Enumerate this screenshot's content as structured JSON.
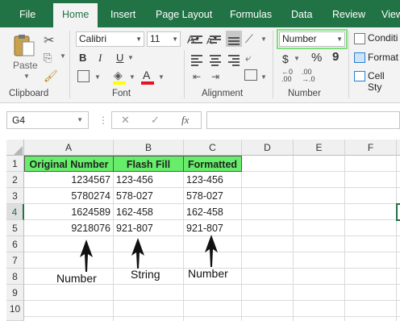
{
  "tabs": [
    {
      "label": "File"
    },
    {
      "label": "Home"
    },
    {
      "label": "Insert"
    },
    {
      "label": "Page Layout"
    },
    {
      "label": "Formulas"
    },
    {
      "label": "Data"
    },
    {
      "label": "Review"
    },
    {
      "label": "View"
    }
  ],
  "ribbon": {
    "clipboard": {
      "paste_label": "Paste",
      "group_label": "Clipboard"
    },
    "font": {
      "font_name": "Calibri",
      "font_size": "11",
      "bold": "B",
      "italic": "I",
      "underline": "U",
      "grow": "A",
      "shrink": "A",
      "fill_color": "#ffff00",
      "font_color": "#e81123",
      "group_label": "Font"
    },
    "alignment": {
      "group_label": "Alignment"
    },
    "number": {
      "format": "Number",
      "currency": "$",
      "percent": "%",
      "comma": "9",
      "group_label": "Number"
    },
    "styles": {
      "cond_format": "Conditi",
      "format_as": "Format",
      "cell_styles": "Cell Sty"
    }
  },
  "formula_bar": {
    "name_box": "G4",
    "fx": "fx",
    "value": ""
  },
  "sheet": {
    "columns": [
      "A",
      "B",
      "C",
      "D",
      "E",
      "F"
    ],
    "rows": [
      "1",
      "2",
      "3",
      "4",
      "5",
      "6",
      "7",
      "8",
      "9",
      "10"
    ],
    "header": [
      "Original Number",
      "Flash Fill",
      "Formatted"
    ],
    "data": [
      [
        "1234567",
        "123-456",
        "123-456"
      ],
      [
        "5780274",
        "578-027",
        "578-027"
      ],
      [
        "1624589",
        "162-458",
        "162-458"
      ],
      [
        "9218076",
        "921-807",
        "921-807"
      ]
    ],
    "header_fill": "#66ee6a"
  },
  "annotations": {
    "a": "Number",
    "b": "String",
    "c": "Number"
  }
}
